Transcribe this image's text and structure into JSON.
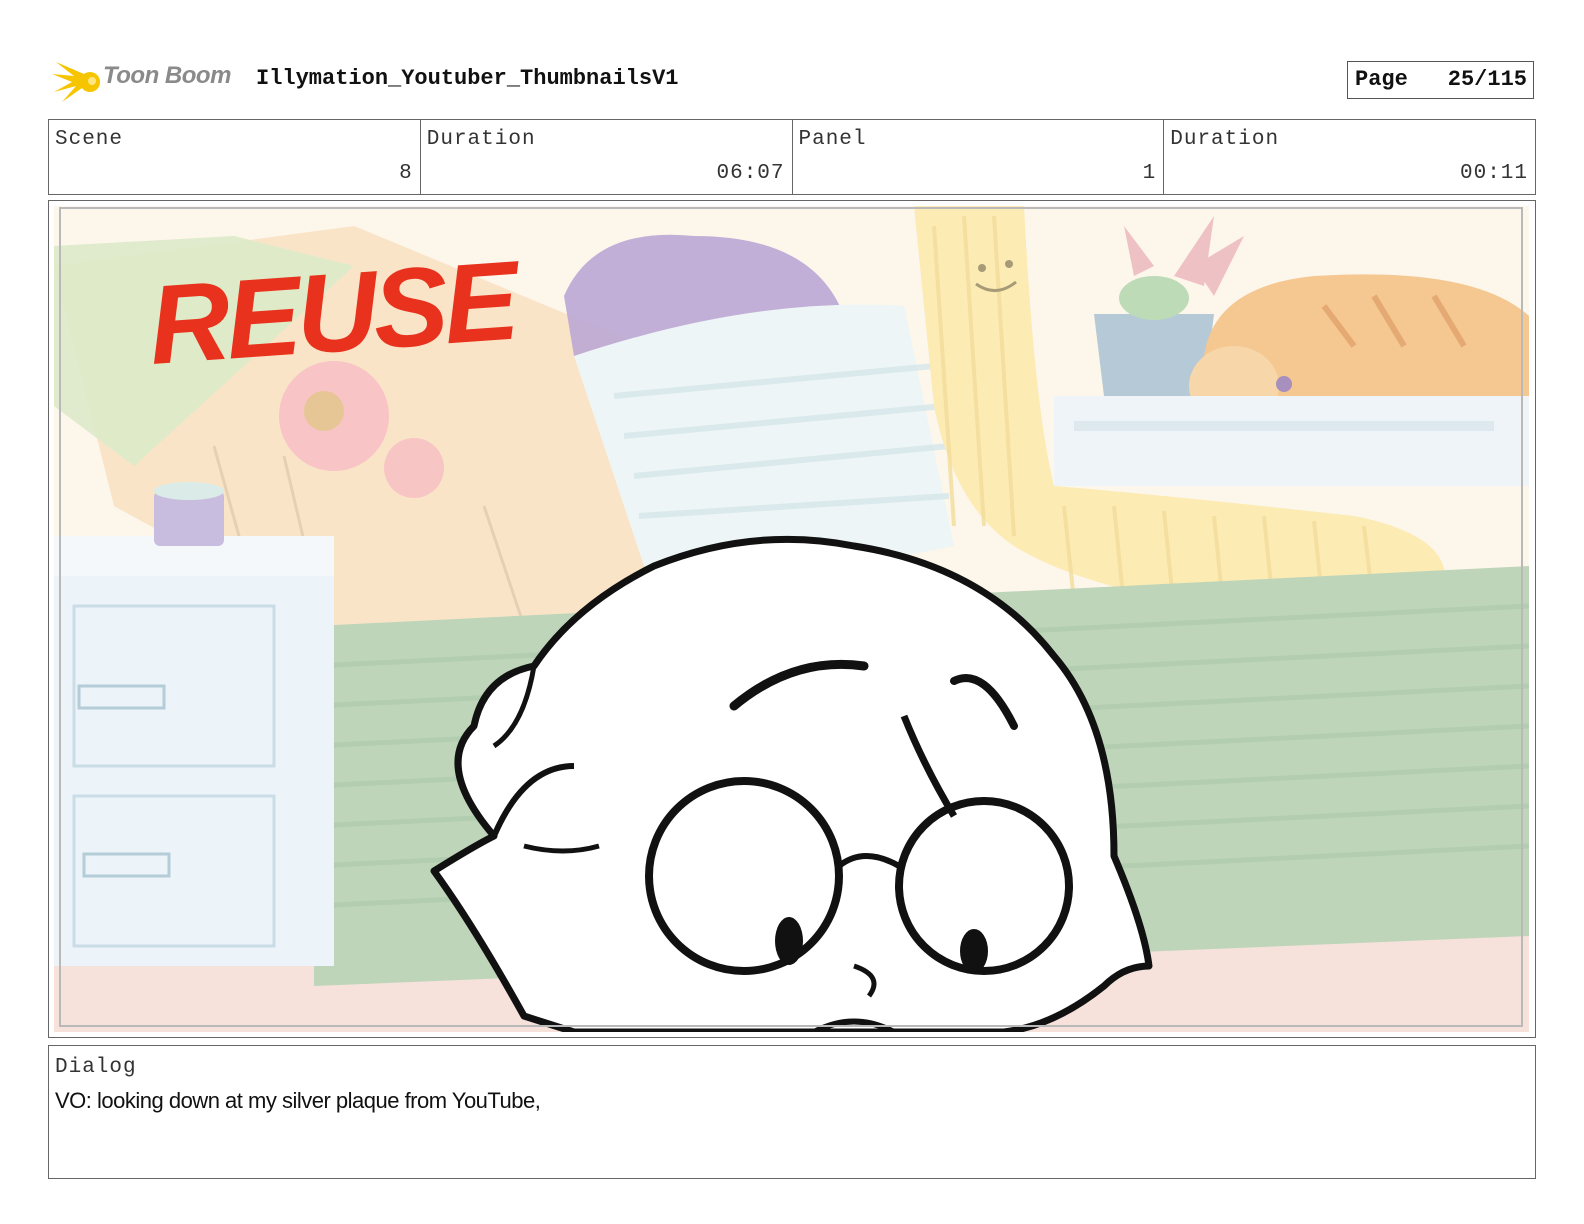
{
  "header": {
    "logo_text": "Toon Boom",
    "project_title": "Illymation_Youtuber_ThumbnailsV1",
    "page_label": "Page",
    "page_value": "25/115"
  },
  "info": {
    "scene_label": "Scene",
    "scene_value": "8",
    "scene_duration_label": "Duration",
    "scene_duration_value": "06:07",
    "panel_label": "Panel",
    "panel_value": "1",
    "panel_duration_label": "Duration",
    "panel_duration_value": "00:11"
  },
  "panel": {
    "stamp_text": "REUSE",
    "stamp_color": "#e8321e"
  },
  "dialog": {
    "label": "Dialog",
    "text": "VO: looking down at my silver plaque from YouTube,"
  },
  "colors": {
    "logo_accent": "#f7c500",
    "border": "#666666"
  }
}
